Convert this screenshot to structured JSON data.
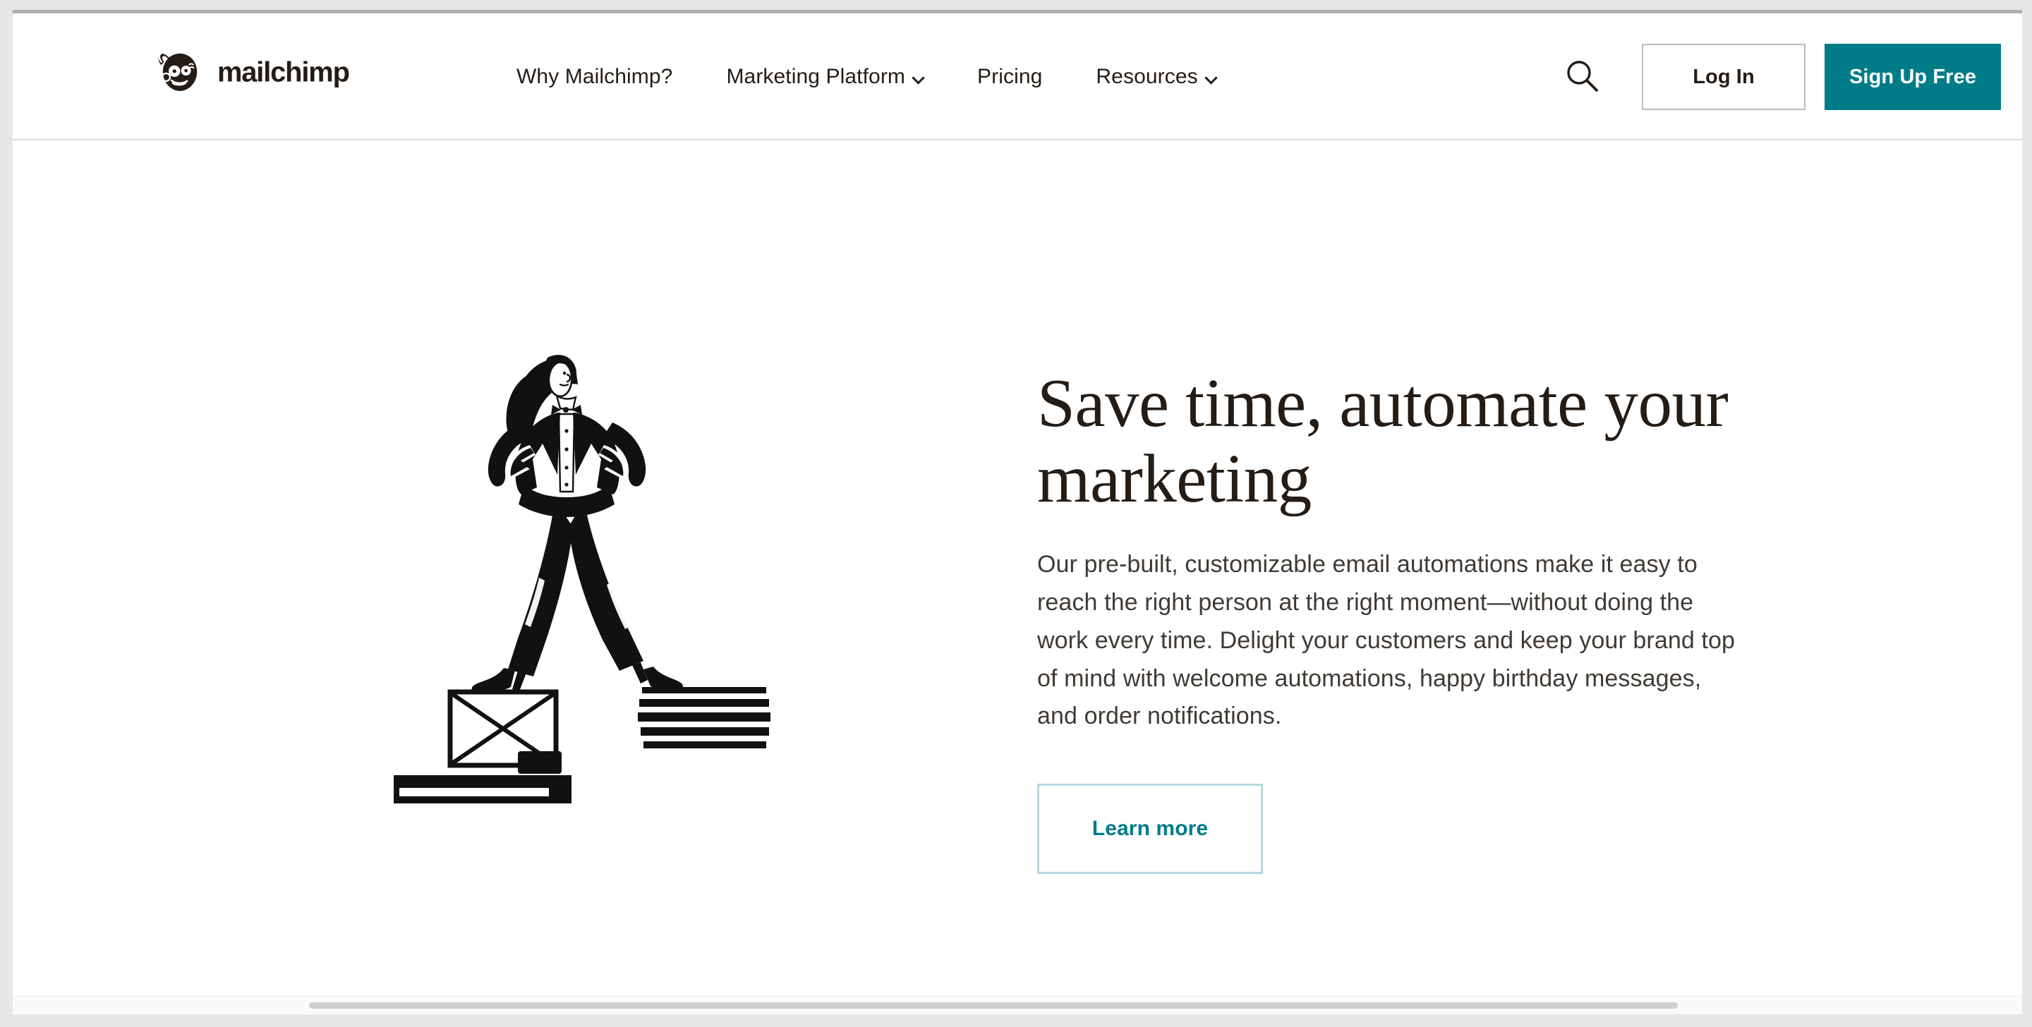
{
  "brand": {
    "name": "mailchimp",
    "accent_color": "#007C89",
    "accent_border_color": "#B3D9DE",
    "text_color": "#241C15"
  },
  "header": {
    "logo_name": "mailchimp-logo",
    "nav": [
      {
        "label": "Why Mailchimp?",
        "has_dropdown": false
      },
      {
        "label": "Marketing Platform",
        "has_dropdown": true
      },
      {
        "label": "Pricing",
        "has_dropdown": false
      },
      {
        "label": "Resources",
        "has_dropdown": true
      }
    ],
    "search_icon": "search-icon",
    "login_label": "Log In",
    "signup_label": "Sign Up Free"
  },
  "hero": {
    "illustration_name": "woman-standing-on-envelope-illustration",
    "title": "Save time, automate your marketing",
    "description": "Our pre-built, customizable email automations make it easy to reach the right person at the right moment—without doing the work every time. Delight your customers and keep your brand top of mind with welcome automations, happy birthday messages, and order notifications.",
    "cta_label": "Learn more"
  }
}
